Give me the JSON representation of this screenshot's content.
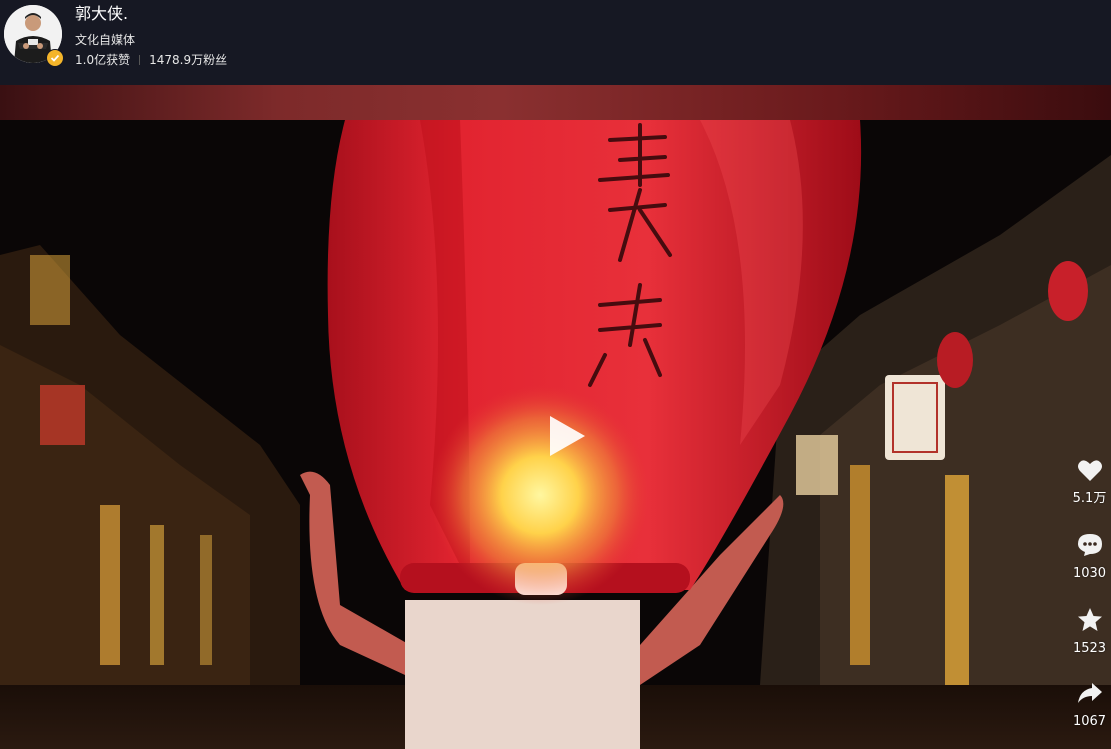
{
  "header": {
    "name": "郭大侠.",
    "description": "文化自媒体",
    "likes": "1.0亿获赞",
    "fans": "1478.9万粉丝"
  },
  "video": {
    "lantern_text": "郭大侠",
    "actions": [
      {
        "icon": "heart-icon",
        "count": "5.1万"
      },
      {
        "icon": "comment-icon",
        "count": "1030"
      },
      {
        "icon": "star-icon",
        "count": "1523"
      },
      {
        "icon": "share-icon",
        "count": "1067"
      }
    ]
  },
  "colors": {
    "background": "#161823",
    "verified_badge": "#f4b52a",
    "lantern_red": "#d8202a"
  }
}
